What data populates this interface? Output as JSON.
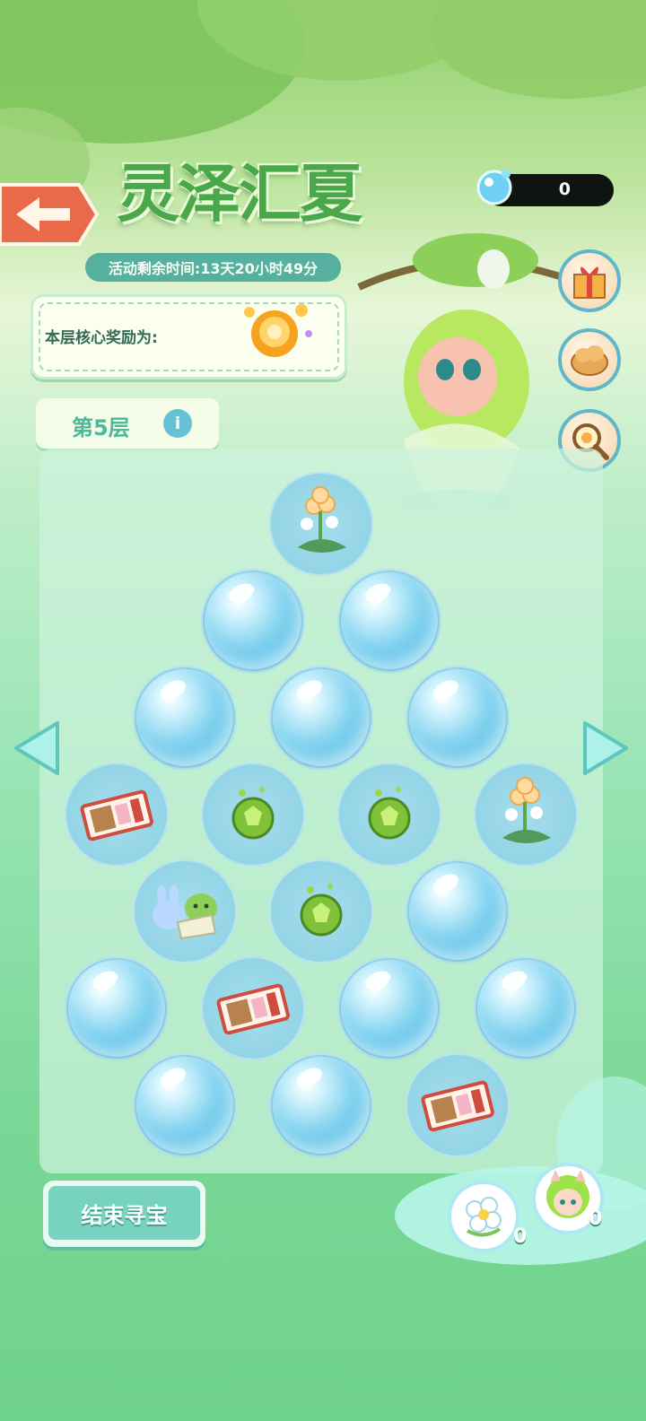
{
  "header": {
    "title": "灵泽汇夏",
    "timer": "活动剩余时间:13天20小时49分",
    "currency_value": "0",
    "currency_icon": "water-drop-icon"
  },
  "reward": {
    "label": "本层核心奖励为:",
    "icon": "golden-flower-orb-icon"
  },
  "floor": {
    "label": "第5层",
    "info_glyph": "i"
  },
  "side_buttons": [
    "gift-box-icon",
    "cloud-pastry-icon",
    "magnifier-search-icon"
  ],
  "board": {
    "rows": [
      [
        "flower"
      ],
      [
        "bubble",
        "bubble"
      ],
      [
        "bubble",
        "bubble",
        "bubble"
      ],
      [
        "ticket",
        "green-orb",
        "green-orb",
        "flower"
      ],
      [
        "bunny-plush",
        "green-orb",
        "bubble"
      ],
      [
        "bubble",
        "ticket",
        "bubble",
        "bubble"
      ],
      [
        "bubble",
        "bubble",
        "ticket"
      ]
    ]
  },
  "end_button": "结束寻宝",
  "collectibles": [
    {
      "icon": "white-flower-icon",
      "count": "0"
    },
    {
      "icon": "green-hair-girl-avatar-icon",
      "count": "0"
    }
  ],
  "colors": {
    "bubble": "#86d4f0",
    "cell": "#92d4e6",
    "accent": "#4db89c",
    "currency_bg": "#0f1410"
  }
}
